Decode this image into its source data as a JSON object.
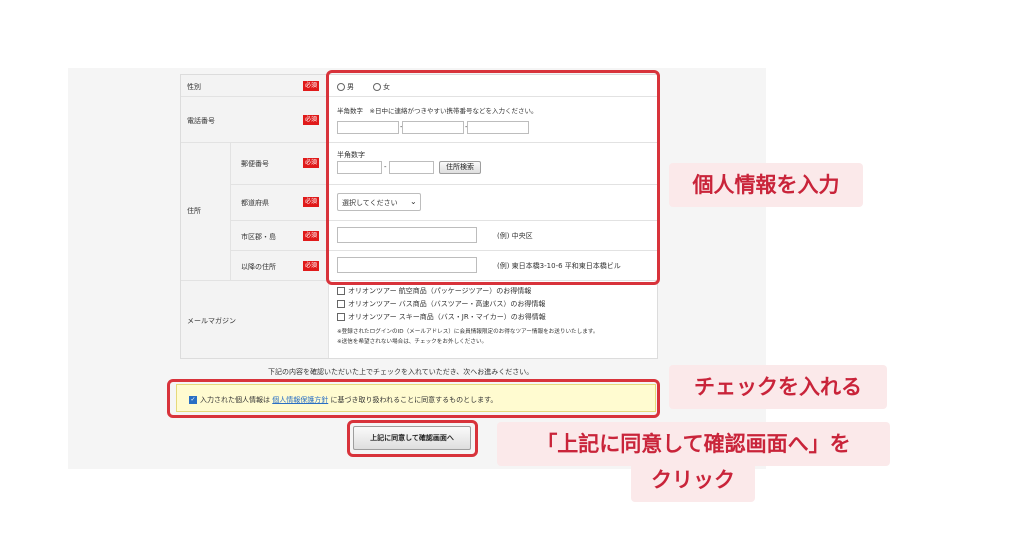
{
  "form": {
    "gender": {
      "label": "性別",
      "required": "必須",
      "options": [
        "男",
        "女"
      ]
    },
    "phone": {
      "label": "電話番号",
      "required": "必須",
      "hint": "半角数字　※日中に連絡がつきやすい携帯番号などを入力ください。",
      "sep1": "-",
      "sep2": "-"
    },
    "address": {
      "label": "住所",
      "postal": {
        "label": "郵便番号",
        "required": "必須",
        "hint": "半角数字",
        "sep": "-",
        "search_button": "住所検索"
      },
      "prefecture": {
        "label": "都道府県",
        "required": "必須",
        "select_value": "選択してください"
      },
      "city": {
        "label": "市区郡・島",
        "required": "必須",
        "example": "(例) 中央区"
      },
      "street": {
        "label": "以降の住所",
        "required": "必須",
        "example": "(例) 東日本橋3-10-6 平和東日本橋ビル"
      }
    },
    "newsletter": {
      "label": "メールマガジン",
      "options": [
        "オリオンツアー 航空商品（パッケージツアー）のお得情報",
        "オリオンツアー バス商品（バスツアー・高速バス）のお得情報",
        "オリオンツアー スキー商品（バス・JR・マイカー）のお得情報"
      ],
      "note1": "※登録されたログインのID（メールアドレス）に会員情報限定のお得なツアー情報をお送りいたします。",
      "note2": "※送信を希望されない場合は、チェックをお外しください。"
    }
  },
  "instruction": "下記の内容を確認いただいた上でチェックを入れていただき、次へお進みください。",
  "consent": {
    "checked": true,
    "pre": "入力された個人情報は",
    "link": "個人情報保護方針",
    "post": "に基づき取り扱われることに同意するものとします。"
  },
  "submit_button": "上記に同意して確認画面へ",
  "annotations": {
    "personal_info": "個人情報を入力",
    "check": "チェックを入れる",
    "click_line1": "「上記に同意して確認画面へ」を",
    "click_line2": "クリック"
  },
  "colors": {
    "highlight": "#d8333b",
    "required": "#e01a1a",
    "callout_bg": "#fbe9ea",
    "consent_bg": "#fffbd0"
  }
}
